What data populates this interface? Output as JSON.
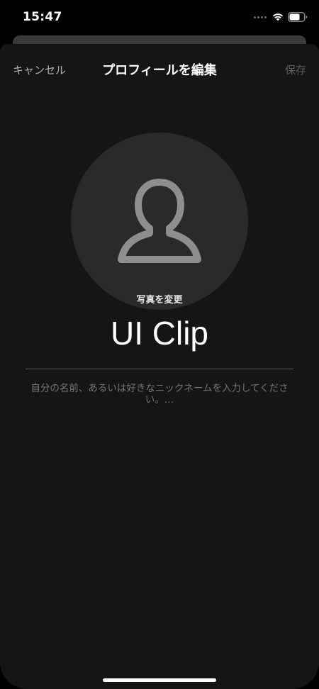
{
  "status_bar": {
    "time": "15:47"
  },
  "nav": {
    "cancel_label": "キャンセル",
    "title": "プロフィールを編集",
    "save_label": "保存"
  },
  "profile": {
    "change_photo_label": "写真を変更",
    "name_value": "UI Clip",
    "bio_placeholder": "自分の名前、あるいは好きなニックネームを入力してください。…"
  },
  "colors": {
    "sheet_background": "#151515",
    "avatar_background": "#2a2a2a",
    "avatar_icon": "#8e8e8e",
    "save_disabled": "#5c5c5c"
  },
  "icons": {
    "avatar": "person-icon",
    "wifi": "wifi-icon",
    "battery": "battery-icon"
  }
}
